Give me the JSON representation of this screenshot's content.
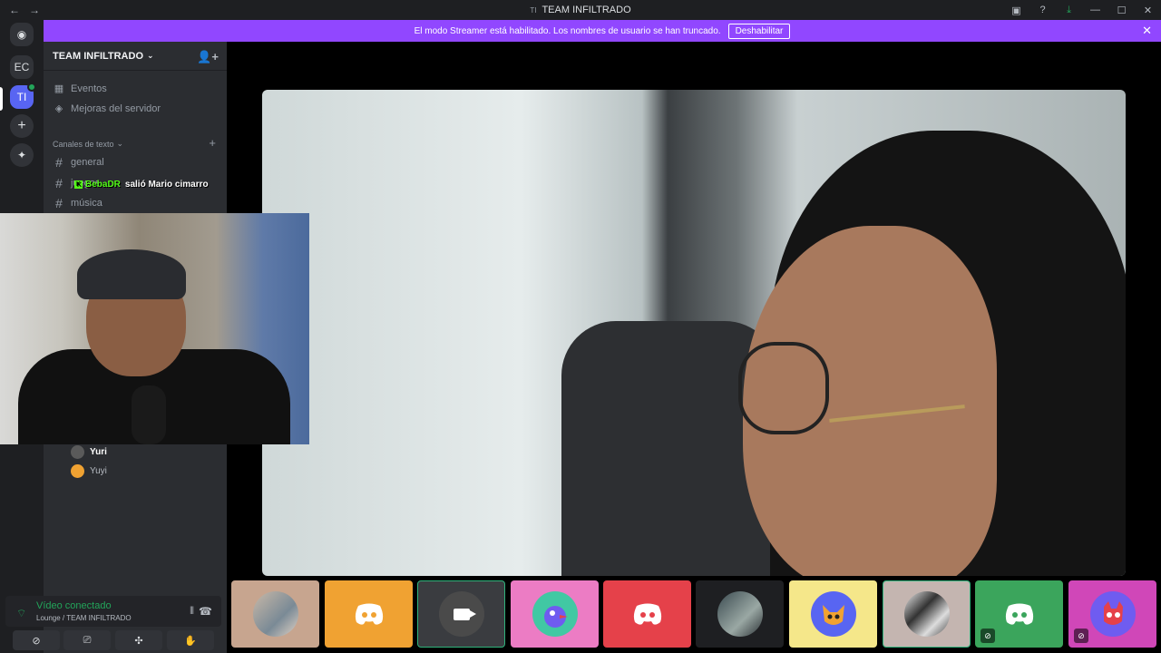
{
  "window": {
    "title": "TEAM INFILTRADO",
    "title_glyph": "TI",
    "back": "←",
    "forward": "→",
    "icons": [
      "inbox-icon",
      "help-icon",
      "download-icon",
      "minimize-icon",
      "maximize-icon",
      "close-icon"
    ],
    "icon_glyphs": [
      "▣",
      "?",
      "⤓",
      "—",
      "☐",
      "✕"
    ]
  },
  "servers": {
    "discord_glyph": "◉",
    "items": [
      "EC",
      "TI"
    ],
    "add_glyph": "+",
    "explore_glyph": "✦"
  },
  "banner": {
    "text": "El modo Streamer está habilitado. Los nombres de usuario se han truncado.",
    "button": "Deshabilitar",
    "close": "✕"
  },
  "sidebar": {
    "server_name": "TEAM INFILTRADO",
    "chevron": "⌄",
    "invite_glyph": "👤+",
    "items": [
      {
        "icon": "▦",
        "label": "Eventos"
      },
      {
        "icon": "◈",
        "label": "Mejoras del servidor"
      }
    ],
    "category": "Canales de texto",
    "category_chev": "⌄",
    "category_add": "+",
    "channels": [
      "general",
      "juegos",
      "música"
    ],
    "hash": "#"
  },
  "notification": {
    "badge": "K",
    "user": "BebaDR",
    "text": "salió Mario cimarro"
  },
  "members": [
    {
      "name": "Yuri",
      "color": "#ffffff",
      "avatar_bg": "#5a5a5a"
    },
    {
      "name": "Yuyi",
      "color": "#b5bac1",
      "avatar_bg": "#f0a232"
    }
  ],
  "voice": {
    "status": "Vídeo conectado",
    "channel": "Lounge / TEAM INFILTRADO",
    "wave_glyph": "⦀",
    "hangup_glyph": "☎",
    "signal_glyph": "⌔",
    "controls": [
      "⊘",
      "⎚",
      "✣",
      "✋"
    ]
  },
  "tiles": [
    {
      "kind": "photo",
      "bg": "#c7a58f"
    },
    {
      "kind": "discord",
      "bg": "#f0a232"
    },
    {
      "kind": "camera",
      "bg": "#3a3c40",
      "selected": true
    },
    {
      "kind": "avatar",
      "bg": "#ec7cc4",
      "inner": "#41c8a3"
    },
    {
      "kind": "discord",
      "bg": "#e5414a"
    },
    {
      "kind": "photo2",
      "bg": "#1e1f22"
    },
    {
      "kind": "avatar",
      "bg": "#f5e78a",
      "inner": "#5865f2"
    },
    {
      "kind": "photo3",
      "bg": "#c4b5b0",
      "selected": true
    },
    {
      "kind": "discord",
      "bg": "#3ba55c",
      "muted": true
    },
    {
      "kind": "avatar",
      "bg": "#d047b8",
      "inner": "#6f5cf0",
      "muted": true
    }
  ],
  "colors": {
    "accent": "#5865f2",
    "banner": "#9147ff",
    "online": "#23a55a"
  }
}
